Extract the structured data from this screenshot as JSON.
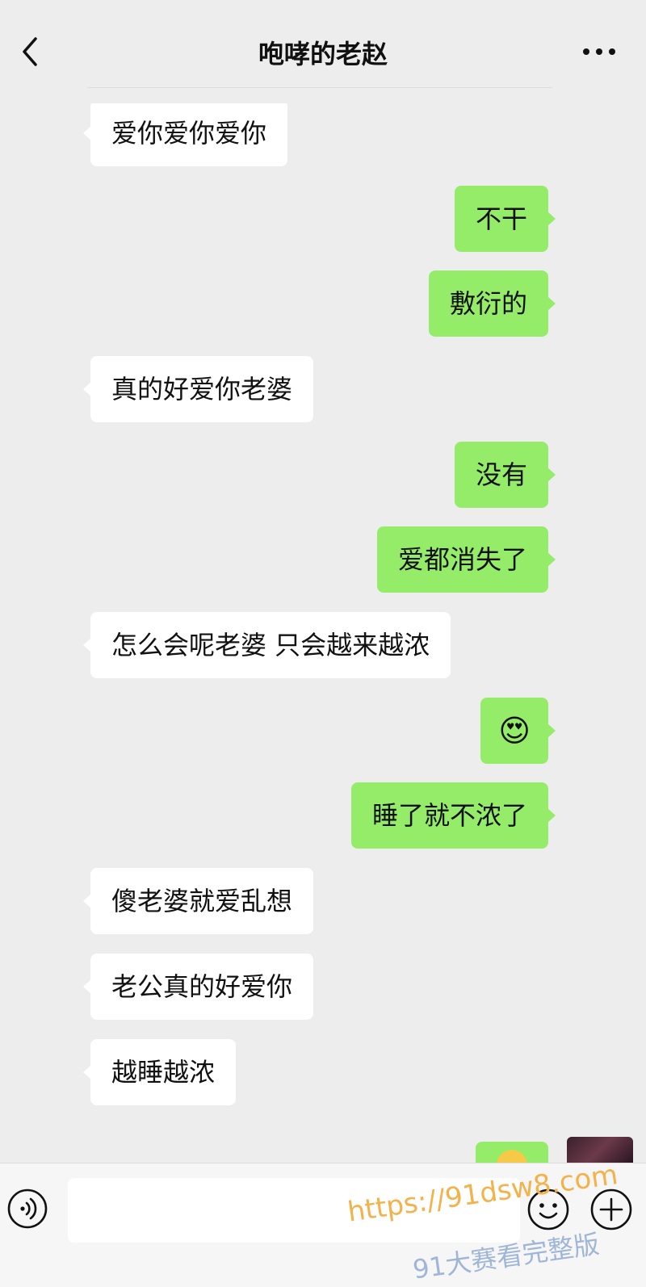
{
  "header": {
    "title": "咆哮的老赵",
    "back_icon": "chevron-left-icon",
    "more_icon": "more-dots-icon"
  },
  "messages": [
    {
      "side": "left",
      "text": "爱你爱你爱你"
    },
    {
      "side": "right",
      "text": "不干"
    },
    {
      "side": "right",
      "text": "敷衍的"
    },
    {
      "side": "left",
      "text": "真的好爱你老婆"
    },
    {
      "side": "right",
      "text": "没有"
    },
    {
      "side": "right",
      "text": "爱都消失了"
    },
    {
      "side": "left",
      "text": "怎么会呢老婆 只会越来越浓"
    },
    {
      "side": "right",
      "text": "😍",
      "type": "emoji"
    },
    {
      "side": "right",
      "text": "睡了就不浓了"
    },
    {
      "side": "left",
      "text": "傻老婆就爱乱想"
    },
    {
      "side": "left",
      "text": "老公真的好爱你"
    },
    {
      "side": "left",
      "text": "越睡越浓"
    }
  ],
  "input_bar": {
    "voice_icon": "voice-icon",
    "input_value": "",
    "emoji_icon": "smiley-icon",
    "plus_icon": "plus-circle-icon"
  },
  "watermark": {
    "url": "https://91dsw8.com",
    "text": "91大赛看完整版"
  },
  "colors": {
    "background": "#ededed",
    "bubble_self": "#95ec69",
    "bubble_other": "#ffffff"
  }
}
